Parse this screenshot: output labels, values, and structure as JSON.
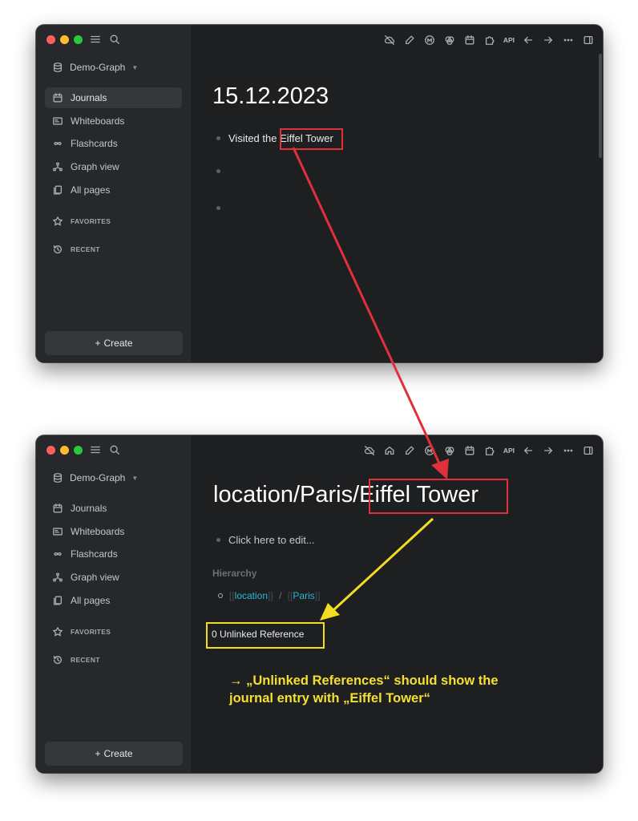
{
  "colors": {
    "red_annotation": "#e0313b",
    "yellow_annotation": "#f3dc21",
    "page_ref": "#2bb6d4"
  },
  "window1": {
    "graph_name": "Demo-Graph",
    "nav": [
      "Journals",
      "Whiteboards",
      "Flashcards",
      "Graph view",
      "All pages"
    ],
    "active_nav": "Journals",
    "favorites_label": "FAVORITES",
    "recent_label": "RECENT",
    "create_label": "Create",
    "create_prefix": "+",
    "api_label": "API",
    "page_title": "15.12.2023",
    "block_text": "Visited the ",
    "block_link": "Eiffel Tower",
    "empty_blocks": 2,
    "toolbar_icons": [
      "cloud-off-icon",
      "pen-icon",
      "m-circle-icon",
      "tour-icon",
      "calendar-icon",
      "puzzle-icon",
      "api",
      "arrow-left-icon",
      "arrow-right-icon",
      "more-icon",
      "sidebar-toggle-icon"
    ]
  },
  "window2": {
    "graph_name": "Demo-Graph",
    "nav": [
      "Journals",
      "Whiteboards",
      "Flashcards",
      "Graph view",
      "All pages"
    ],
    "favorites_label": "FAVORITES",
    "recent_label": "RECENT",
    "create_label": "Create",
    "create_prefix": "+",
    "api_label": "API",
    "page_title_prefix": "location/Paris/",
    "page_title_highlight": "Eiffel Tower",
    "block_placeholder": "Click here to edit...",
    "hierarchy_label": "Hierarchy",
    "hierarchy_links": [
      "location",
      "Paris"
    ],
    "hierarchy_separator": "/",
    "bracket_open": "[[",
    "bracket_close": "]]",
    "unlinked_references": "0 Unlinked Reference",
    "toolbar_icons": [
      "cloud-off-icon",
      "home-icon",
      "pen-icon",
      "m-circle-icon",
      "tour-icon",
      "calendar-icon",
      "puzzle-icon",
      "api",
      "arrow-left-icon",
      "arrow-right-icon",
      "more-icon",
      "sidebar-toggle-icon"
    ]
  },
  "annotation": {
    "line1": "→ „Unlinked References“ should show the",
    "line2": "journal entry with „Eiffel Tower“"
  }
}
